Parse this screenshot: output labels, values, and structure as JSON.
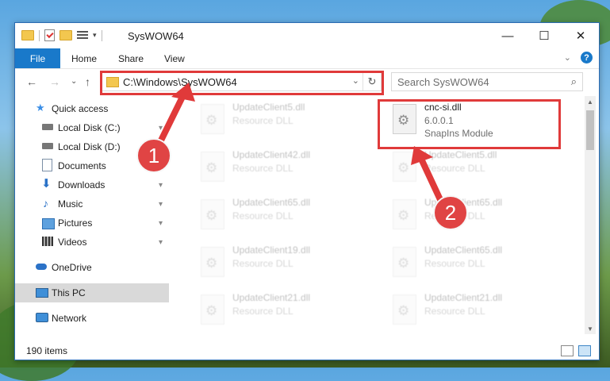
{
  "window": {
    "title": "SysWOW64",
    "buttons": {
      "minimize": "—",
      "maximize": "☐",
      "close": "✕"
    }
  },
  "ribbon": {
    "tabs": [
      "File",
      "Home",
      "Share",
      "View"
    ],
    "help": "?",
    "chevron": "⌄"
  },
  "nav": {
    "back": "←",
    "forward": "→",
    "recent": "⌄",
    "up": "↑",
    "address": "C:\\Windows\\SysWOW64",
    "address_dropdown": "⌄",
    "refresh": "↻",
    "search_placeholder": "Search SysWOW64",
    "search_icon": "⌕"
  },
  "sidebar": {
    "items": [
      {
        "label": "Quick access",
        "icon": "star-icon",
        "pinned": false
      },
      {
        "label": "Local Disk (C:)",
        "icon": "drive-icon",
        "pinned": true
      },
      {
        "label": "Local Disk (D:)",
        "icon": "drive-icon",
        "pinned": true
      },
      {
        "label": "Documents",
        "icon": "documents-icon",
        "pinned": true
      },
      {
        "label": "Downloads",
        "icon": "download-icon",
        "pinned": true
      },
      {
        "label": "Music",
        "icon": "music-icon",
        "pinned": true
      },
      {
        "label": "Pictures",
        "icon": "pictures-icon",
        "pinned": true
      },
      {
        "label": "Videos",
        "icon": "videos-icon",
        "pinned": true
      },
      {
        "label": "OneDrive",
        "icon": "cloud-icon",
        "pinned": false
      },
      {
        "label": "This PC",
        "icon": "computer-icon",
        "pinned": false,
        "selected": true
      },
      {
        "label": "Network",
        "icon": "network-icon",
        "pinned": false
      }
    ],
    "pin_glyph": "📌"
  },
  "files": {
    "left_column": [
      {
        "name": "UpdateClient5.dll",
        "type": "Resource DLL"
      },
      {
        "name": "UpdateClient42.dll",
        "type": "Resource DLL"
      },
      {
        "name": "UpdateClient65.dll",
        "type": "Resource DLL"
      },
      {
        "name": "UpdateClient19.dll",
        "type": "Resource DLL"
      },
      {
        "name": "UpdateClient21.dll",
        "type": "Resource DLL"
      }
    ],
    "highlighted": {
      "name": "cnc-si.dll",
      "version": "6.0.0.1",
      "description": "SnapIns Module"
    },
    "right_column": [
      {
        "name": "UpdateClient5.dll",
        "type": "Resource DLL"
      },
      {
        "name": "UpdateClient65.dll",
        "type": "Resource DLL"
      },
      {
        "name": "UpdateClient65.dll",
        "type": "Resource DLL"
      },
      {
        "name": "UpdateClient21.dll",
        "type": "Resource DLL"
      }
    ]
  },
  "status": {
    "item_count": "190 items"
  },
  "annotations": {
    "step1": "1",
    "step2": "2",
    "color": "#e03a3a"
  }
}
